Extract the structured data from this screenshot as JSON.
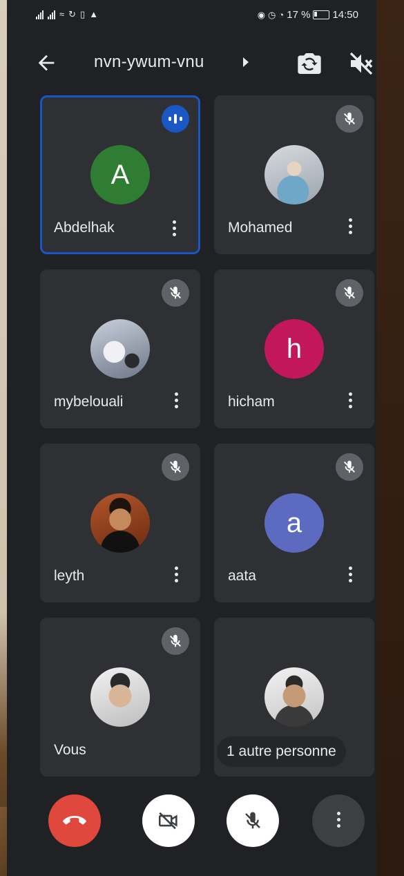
{
  "status_bar": {
    "percent": "17 %",
    "time": "14:50"
  },
  "meeting": {
    "code": "nvn-ywum-vnu"
  },
  "participants": [
    {
      "name": "Abdelhak",
      "initial": "A",
      "color": "#2e7d32",
      "speaking": true,
      "muted": false,
      "photo": false
    },
    {
      "name": "Mohamed",
      "initial": "",
      "color": "",
      "speaking": false,
      "muted": true,
      "photo": true
    },
    {
      "name": "mybelouali",
      "initial": "",
      "color": "",
      "speaking": false,
      "muted": true,
      "photo": true
    },
    {
      "name": "hicham",
      "initial": "h",
      "color": "#c2185b",
      "speaking": false,
      "muted": true,
      "photo": false
    },
    {
      "name": "leyth",
      "initial": "",
      "color": "",
      "speaking": false,
      "muted": true,
      "photo": true
    },
    {
      "name": "aata",
      "initial": "a",
      "color": "#5c6bc0",
      "speaking": false,
      "muted": true,
      "photo": false
    },
    {
      "name": "Vous",
      "initial": "",
      "color": "",
      "speaking": false,
      "muted": true,
      "photo": true
    }
  ],
  "others_chip": "1 autre personne",
  "colors": {
    "background": "#202124",
    "tile": "#2f3033",
    "accent": "#1a56c4",
    "hangup": "#e0483e"
  },
  "icons": {
    "back": "arrow-left-icon",
    "switch_camera": "switch-camera-icon",
    "speaker": "speaker-off-icon",
    "muted": "mic-off-icon",
    "hangup": "phone-hangup-icon",
    "camera": "camera-off-icon",
    "mic": "mic-off-icon",
    "more": "more-vert-icon"
  }
}
